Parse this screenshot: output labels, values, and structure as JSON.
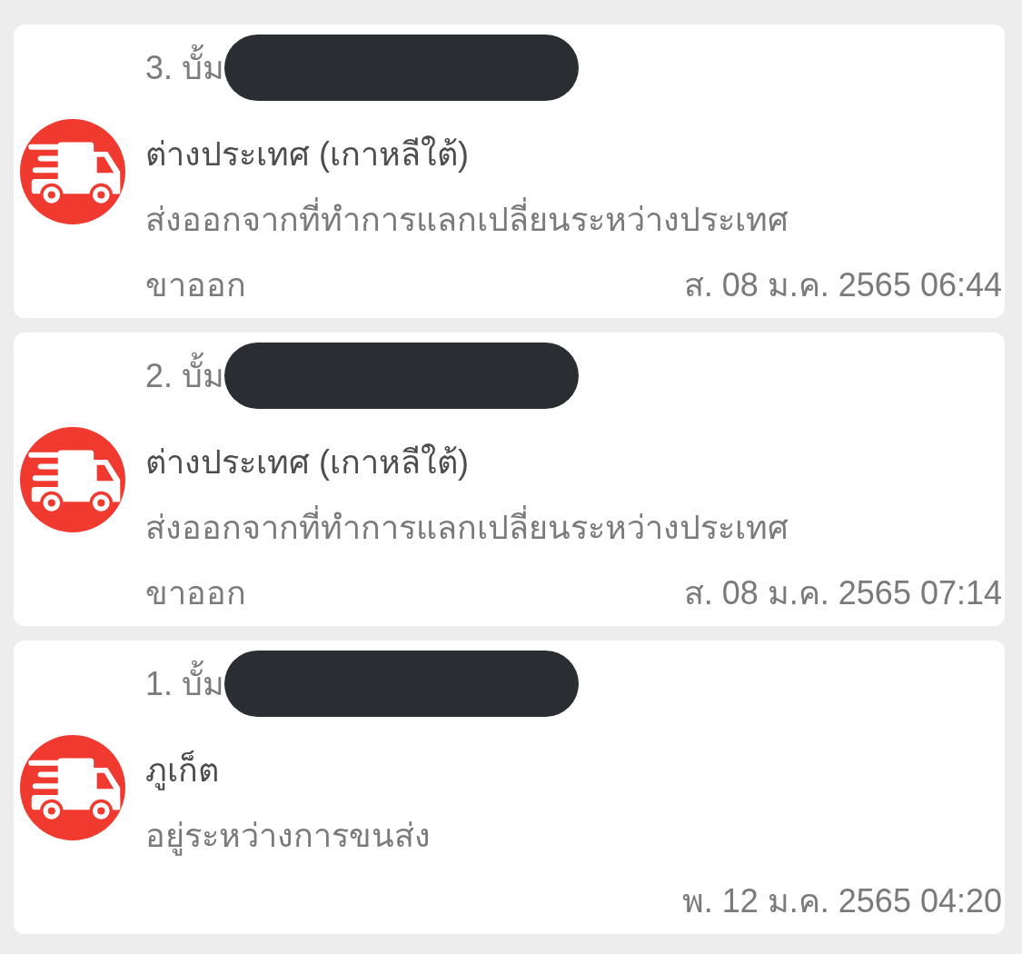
{
  "events": [
    {
      "step": "3. บั้ม",
      "redacted": true,
      "location": "ต่างประเทศ (เกาหลีใต้)",
      "status": "ส่งออกจากที่ทำการแลกเปลี่ยนระหว่างประเทศ",
      "direction": "ขาออก",
      "time": "ส. 08 ม.ค. 2565 06:44"
    },
    {
      "step": "2. บั้ม",
      "redacted": true,
      "location": "ต่างประเทศ (เกาหลีใต้)",
      "status": "ส่งออกจากที่ทำการแลกเปลี่ยนระหว่างประเทศ",
      "direction": "ขาออก",
      "time": "ส. 08 ม.ค. 2565 07:14"
    },
    {
      "step": "1. บั้ม",
      "redacted": true,
      "location": "ภูเก็ต",
      "status": "อยู่ระหว่างการขนส่ง",
      "time": "พ. 12 ม.ค. 2565 04:20"
    }
  ]
}
